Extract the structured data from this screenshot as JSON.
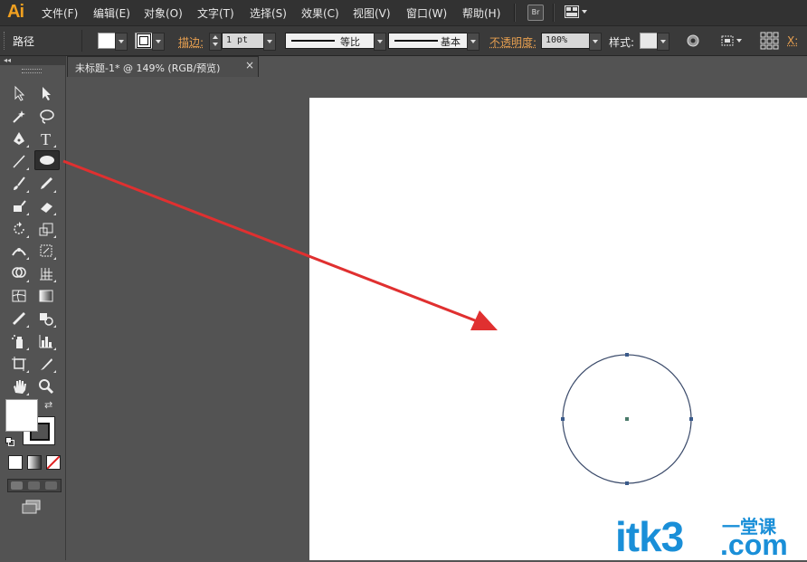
{
  "app": {
    "logo": "Ai"
  },
  "menu": {
    "items": [
      "文件(F)",
      "编辑(E)",
      "对象(O)",
      "文字(T)",
      "选择(S)",
      "效果(C)",
      "视图(V)",
      "窗口(W)",
      "帮助(H)"
    ],
    "bridge_label": "Br"
  },
  "control": {
    "selection_label": "路径",
    "stroke_label": "描边:",
    "stroke_weight": "1 pt",
    "profile_label": "等比",
    "brush_label": "基本",
    "opacity_label": "不透明度:",
    "opacity_value": "100%",
    "style_label": "样式:",
    "x_label": "X:"
  },
  "document": {
    "tab_title": "未标题-1* @ 149% (RGB/预览)",
    "tab_close": "×"
  },
  "watermark": {
    "text": "itk3",
    "suffix": "一堂课",
    "domain": ".com"
  },
  "colors": {
    "accent_orange": "#e8a050",
    "annotation_red": "#e03030",
    "circle_stroke": "#3a4a6a",
    "watermark_blue": "#1a8fd8"
  }
}
